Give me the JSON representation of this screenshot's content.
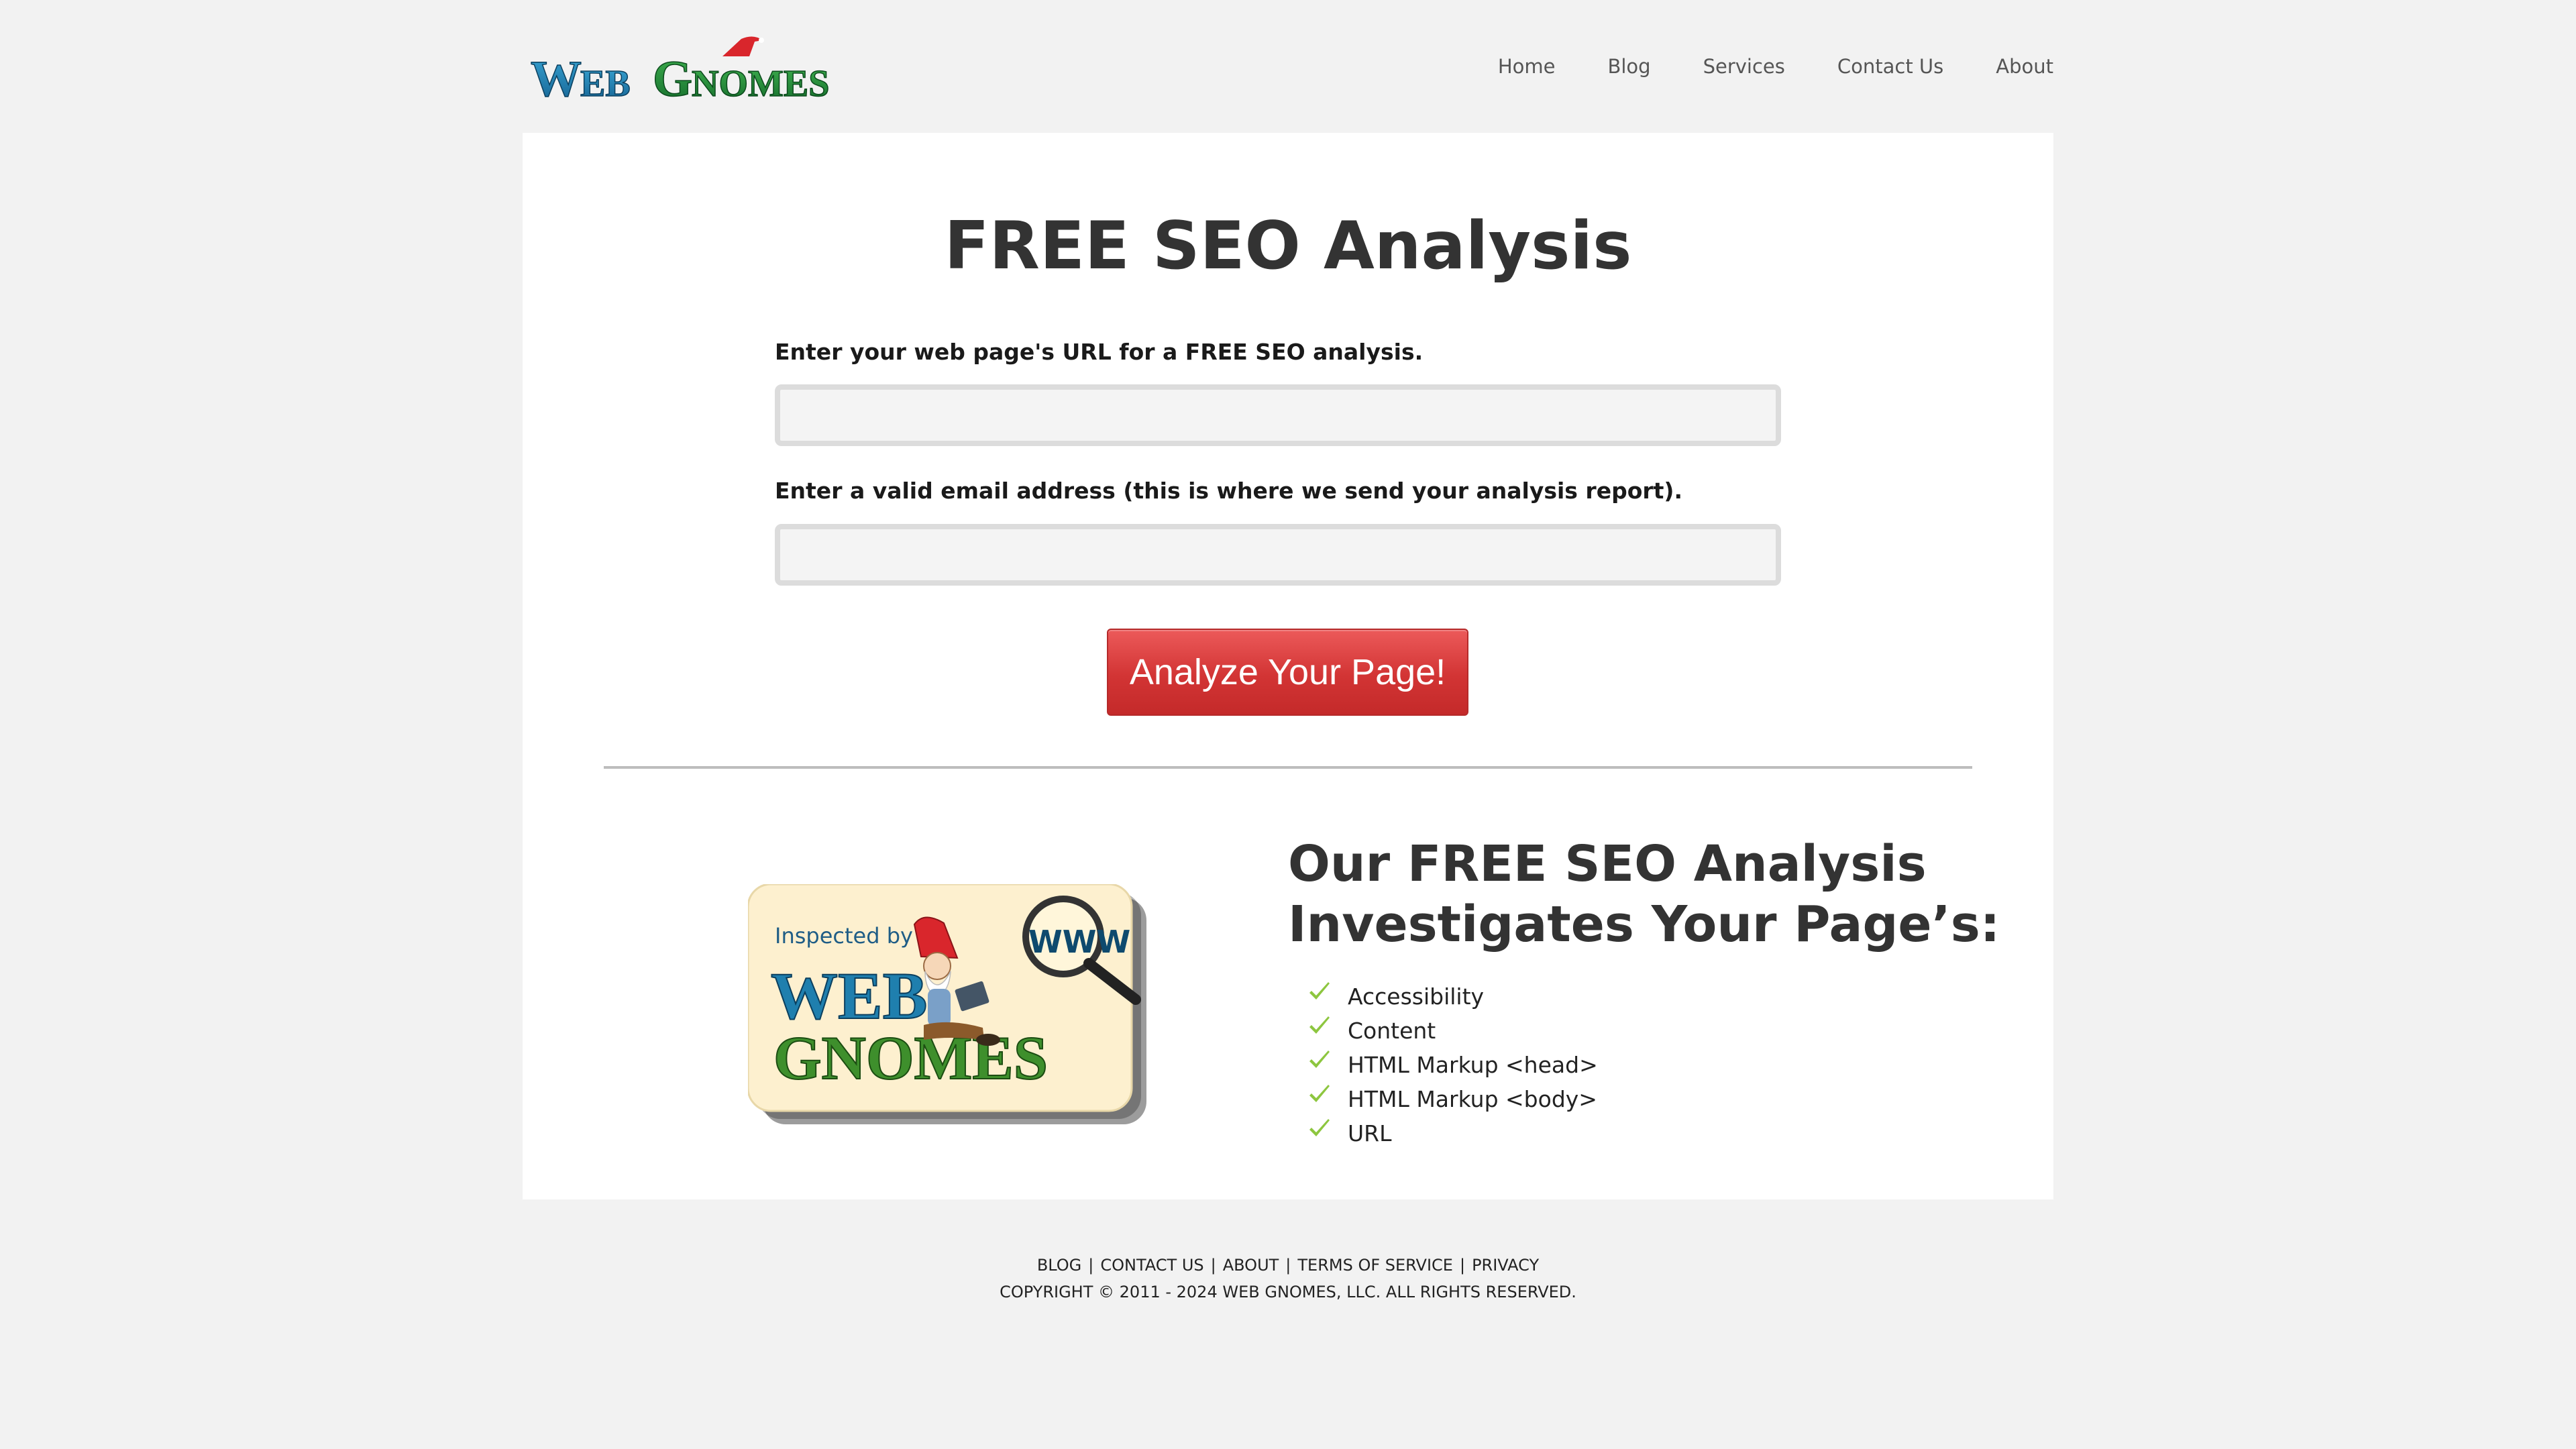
{
  "header": {
    "logo_text": "WEB GNOMES",
    "nav": [
      {
        "label": "Home"
      },
      {
        "label": "Blog"
      },
      {
        "label": "Services"
      },
      {
        "label": "Contact Us"
      },
      {
        "label": "About"
      }
    ]
  },
  "main": {
    "title": "FREE SEO Analysis",
    "url_label": "Enter your web page's URL for a FREE SEO analysis.",
    "url_value": "",
    "email_label": "Enter a valid email address (this is where we send your analysis report).",
    "email_value": "",
    "submit_label": "Analyze Your Page!",
    "badge": {
      "line1": "Inspected by",
      "line2": "WEB",
      "line3": "GNOMES",
      "magnifier_text": "WWW"
    },
    "section_heading_line1": "Our FREE SEO Analysis",
    "section_heading_line2": "Investigates Your Page’s:",
    "features": [
      "Accessibility",
      "Content",
      "HTML Markup <head>",
      "HTML Markup <body>",
      "URL"
    ]
  },
  "footer": {
    "links": [
      "BLOG",
      "CONTACT US",
      "ABOUT",
      "TERMS OF SERVICE",
      "PRIVACY"
    ],
    "separator": "|",
    "copyright": "COPYRIGHT © 2011 - 2024 WEB GNOMES, LLC. ALL RIGHTS RESERVED."
  },
  "colors": {
    "page_bg": "#f2f2f2",
    "card_bg": "#ffffff",
    "button_red": "#d23434",
    "logo_blue": "#1f7fae",
    "logo_green": "#1c8a3a",
    "hat_red": "#d9262c",
    "check_green": "#8dc63f"
  },
  "icons": {
    "check": "check-icon",
    "logo": "web-gnomes-logo",
    "badge": "inspected-by-web-gnomes-badge"
  }
}
